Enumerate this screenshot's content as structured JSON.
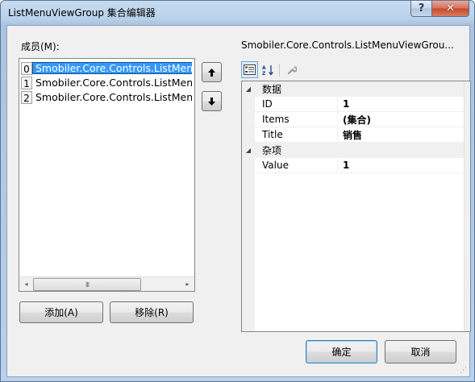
{
  "window": {
    "title": "ListMenuViewGroup 集合编辑器",
    "help_label": "?",
    "close_label": "✕"
  },
  "members": {
    "label": "成员(M):",
    "items": [
      {
        "index": "0",
        "text": "Smobiler.Core.Controls.ListMenu",
        "selected": true
      },
      {
        "index": "1",
        "text": "Smobiler.Core.Controls.ListMenuV",
        "selected": false
      },
      {
        "index": "2",
        "text": "Smobiler.Core.Controls.ListMenuV",
        "selected": false
      }
    ],
    "scroll_thumb_glyph": "III",
    "scroll_left_glyph": "◂",
    "scroll_right_glyph": "▸"
  },
  "move_buttons": {
    "up_glyph": "🡑",
    "down_glyph": "🡓"
  },
  "buttons": {
    "add_label": "添加(A)",
    "remove_label": "移除(R)",
    "ok_label": "确定",
    "cancel_label": "取消"
  },
  "properties": {
    "label": "Smobiler.Core.Controls.ListMenuViewGrou...",
    "toolbar": {
      "categorized_icon": "categorized-icon",
      "alphabetical_icon": "alphabetical-icon",
      "property_pages_icon": "wrench-icon"
    },
    "categories": [
      {
        "name": "数据",
        "expanded": true,
        "props": [
          {
            "name": "ID",
            "value": "1"
          },
          {
            "name": "Items",
            "value": "(集合)"
          },
          {
            "name": "Title",
            "value": "销售"
          }
        ]
      },
      {
        "name": "杂项",
        "expanded": true,
        "props": [
          {
            "name": "Value",
            "value": "1"
          }
        ]
      }
    ],
    "collapse_glyph": "◢"
  },
  "colors": {
    "selection": "#3399ff",
    "title_gradient_top": "#c8dcf0",
    "close_button": "#c44a2e"
  }
}
